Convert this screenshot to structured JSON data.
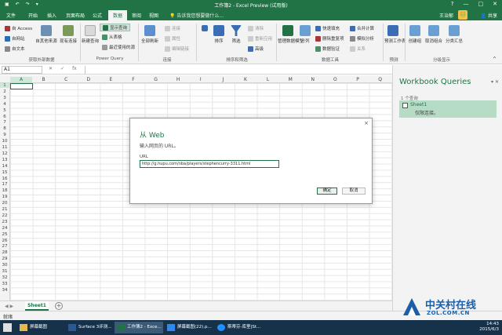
{
  "window": {
    "title": "工作簿2 - Excel Preview (试用版)",
    "controls": [
      "?",
      "—",
      "□",
      "✕"
    ]
  },
  "tabs": [
    {
      "label": "文件"
    },
    {
      "label": "开始"
    },
    {
      "label": "插入"
    },
    {
      "label": "页面布局"
    },
    {
      "label": "公式"
    },
    {
      "label": "数据",
      "active": true
    },
    {
      "label": "审阅"
    },
    {
      "label": "视图"
    }
  ],
  "tell_me": "告诉我您想要做什么...",
  "user": {
    "name": "王治郁",
    "share": "共享"
  },
  "ribbon": {
    "get_external": {
      "items": [
        "自 Access",
        "自网站",
        "自文本"
      ],
      "other": "自其他来源",
      "existing": "现有连接",
      "label": "获取外部数据"
    },
    "power_query": {
      "new_query": "新建查询",
      "show_queries": "显示查询",
      "from_table": "从表格",
      "recent": "最近使用的源",
      "label": "Power Query"
    },
    "connections": {
      "refresh_all": "全部刷新",
      "items": [
        "连接",
        "属性",
        "编辑链接"
      ],
      "label": "连接"
    },
    "sort_filter": {
      "sort": "排序",
      "filter": "筛选",
      "items": [
        "清除",
        "重新应用",
        "高级"
      ],
      "label": "排序和筛选"
    },
    "data_tools": {
      "manage_model": "管理数据模型",
      "split": "分列",
      "items": [
        "快速填充",
        "删除重复项",
        "数据验证",
        "合并计算",
        "模拟分析",
        "关系"
      ],
      "label": "数据工具"
    },
    "forecast": {
      "sheet": "预测工作表",
      "label": "预测"
    },
    "outline": {
      "items": [
        "创建组",
        "取消组合",
        "分类汇总"
      ],
      "label": "分级显示"
    }
  },
  "formula_bar": {
    "name_box": "A1",
    "buttons": [
      "✕",
      "✓",
      "fx"
    ]
  },
  "grid": {
    "columns": [
      "A",
      "B",
      "C",
      "D",
      "E",
      "F",
      "G",
      "H",
      "I",
      "J",
      "K",
      "L",
      "M",
      "N",
      "O",
      "P",
      "Q"
    ],
    "rows": [
      "1",
      "2",
      "3",
      "4",
      "5",
      "6",
      "7",
      "8",
      "9",
      "10",
      "11",
      "12",
      "13",
      "14",
      "15",
      "16",
      "17",
      "18",
      "19",
      "20",
      "21",
      "22",
      "23",
      "24",
      "25",
      "26",
      "27",
      "28",
      "29",
      "30",
      "31",
      "32",
      "33",
      "34"
    ]
  },
  "sheet_tabs": {
    "active": "Sheet1",
    "add": "+"
  },
  "status": "就绪",
  "panel": {
    "title": "Workbook Queries",
    "count": "1 个查询",
    "query_name": "Sheet1",
    "query_status": "仅限连接。"
  },
  "dialog": {
    "title": "从 Web",
    "prompt": "输入网页的 URL。",
    "url_label": "URL",
    "url_value": "http://g.hupu.com/nba/players/stephencurry-3311.html",
    "ok": "确定",
    "cancel": "取消",
    "close": "×"
  },
  "taskbar": {
    "tasks": [
      {
        "label": "屏幕截图",
        "color": "#e8b64a"
      },
      {
        "label": "Surface 3评测...",
        "color": "#2b5797"
      },
      {
        "label": "工作簿2 - Exce...",
        "color": "#217346",
        "active": true
      },
      {
        "label": "屏幕截图(22).p...",
        "color": "#2d89ef"
      },
      {
        "label": "斯蒂芬-库里|St...",
        "color": "#1e90ff"
      }
    ],
    "time": "14:43",
    "date": "2015/6/3"
  },
  "watermark": {
    "line1": "中关村在线",
    "line2": "ZOL.COM.CN"
  }
}
